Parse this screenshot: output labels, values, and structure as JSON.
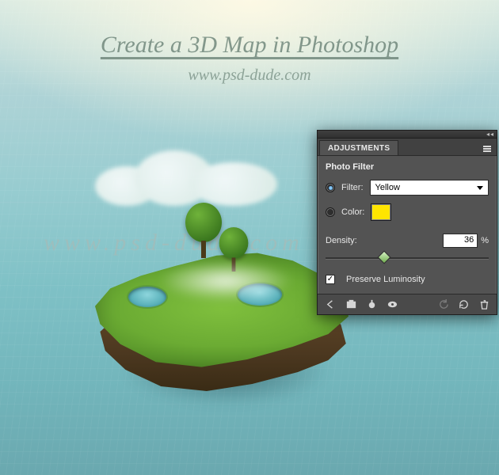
{
  "header": {
    "title": "Create a 3D Map in Photoshop",
    "subtitle": "www.psd-dude.com",
    "watermark": "www.psd-dude.com"
  },
  "panel": {
    "tab_label": "ADJUSTMENTS",
    "heading": "Photo Filter",
    "filter": {
      "radio_label": "Filter:",
      "selected": "Yellow"
    },
    "color": {
      "radio_label": "Color:",
      "swatch_hex": "#ffe500"
    },
    "density": {
      "label": "Density:",
      "value": "36",
      "suffix": "%"
    },
    "preserve_luminosity_label": "Preserve Luminosity"
  }
}
